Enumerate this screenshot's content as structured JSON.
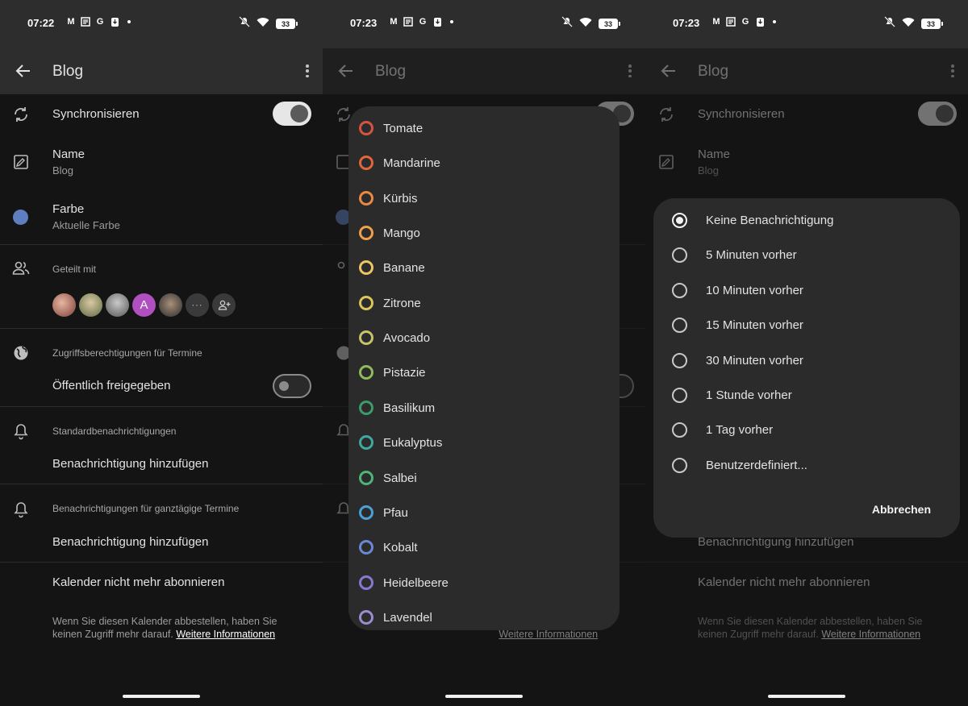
{
  "status": [
    {
      "time": "07:22",
      "battery": "33"
    },
    {
      "time": "07:23",
      "battery": "33"
    },
    {
      "time": "07:23",
      "battery": "33"
    }
  ],
  "status_icons": {
    "gmail": "M",
    "g": "G"
  },
  "appbar": {
    "title": "Blog"
  },
  "settings": {
    "sync_label": "Synchronisieren",
    "name_label": "Name",
    "name_value": "Blog",
    "color_label": "Farbe",
    "color_value": "Aktuelle Farbe",
    "color_hex": "#5e7ebf",
    "shared_label": "Geteilt mit",
    "avatar_letter": "A",
    "avatar_more": "···",
    "avatar_add": "+",
    "access_label": "Zugriffsberechtigungen für Termine",
    "public_label": "Öffentlich freigegeben",
    "default_notif_label": "Standardbenachrichtigungen",
    "add_notif": "Benachrichtigung hinzufügen",
    "allday_notif_label": "Benachrichtigungen für ganztägige Termine",
    "add_notif_allday": "Benachrichtigung hinzufügen",
    "unsubscribe": "Kalender nicht mehr abonnieren",
    "note_text": "Wenn Sie diesen Kalender abbestellen, haben Sie keinen Zugriff mehr darauf.",
    "note_link": "Weitere Informationen"
  },
  "colors": [
    {
      "name": "Tomate",
      "hex": "#d8533f"
    },
    {
      "name": "Mandarine",
      "hex": "#e2663b"
    },
    {
      "name": "Kürbis",
      "hex": "#e98a43"
    },
    {
      "name": "Mango",
      "hex": "#efa048"
    },
    {
      "name": "Banane",
      "hex": "#eec562"
    },
    {
      "name": "Zitrone",
      "hex": "#dcc55a"
    },
    {
      "name": "Avocado",
      "hex": "#c6c46a"
    },
    {
      "name": "Pistazie",
      "hex": "#8fbb5c"
    },
    {
      "name": "Basilikum",
      "hex": "#3d9a6a"
    },
    {
      "name": "Eukalyptus",
      "hex": "#3fa8a0"
    },
    {
      "name": "Salbei",
      "hex": "#4fb47a"
    },
    {
      "name": "Pfau",
      "hex": "#4aa0d8"
    },
    {
      "name": "Kobalt",
      "hex": "#6a88d4"
    },
    {
      "name": "Heidelbeere",
      "hex": "#8a78d0"
    },
    {
      "name": "Lavendel",
      "hex": "#9b8cd0"
    }
  ],
  "notif_options": [
    {
      "label": "Keine Benachrichtigung",
      "checked": true
    },
    {
      "label": "5 Minuten vorher",
      "checked": false
    },
    {
      "label": "10 Minuten vorher",
      "checked": false
    },
    {
      "label": "15 Minuten vorher",
      "checked": false
    },
    {
      "label": "30 Minuten vorher",
      "checked": false
    },
    {
      "label": "1 Stunde vorher",
      "checked": false
    },
    {
      "label": "1 Tag vorher",
      "checked": false
    },
    {
      "label": "Benutzerdefiniert...",
      "checked": false
    }
  ],
  "notif_cancel": "Abbrechen"
}
